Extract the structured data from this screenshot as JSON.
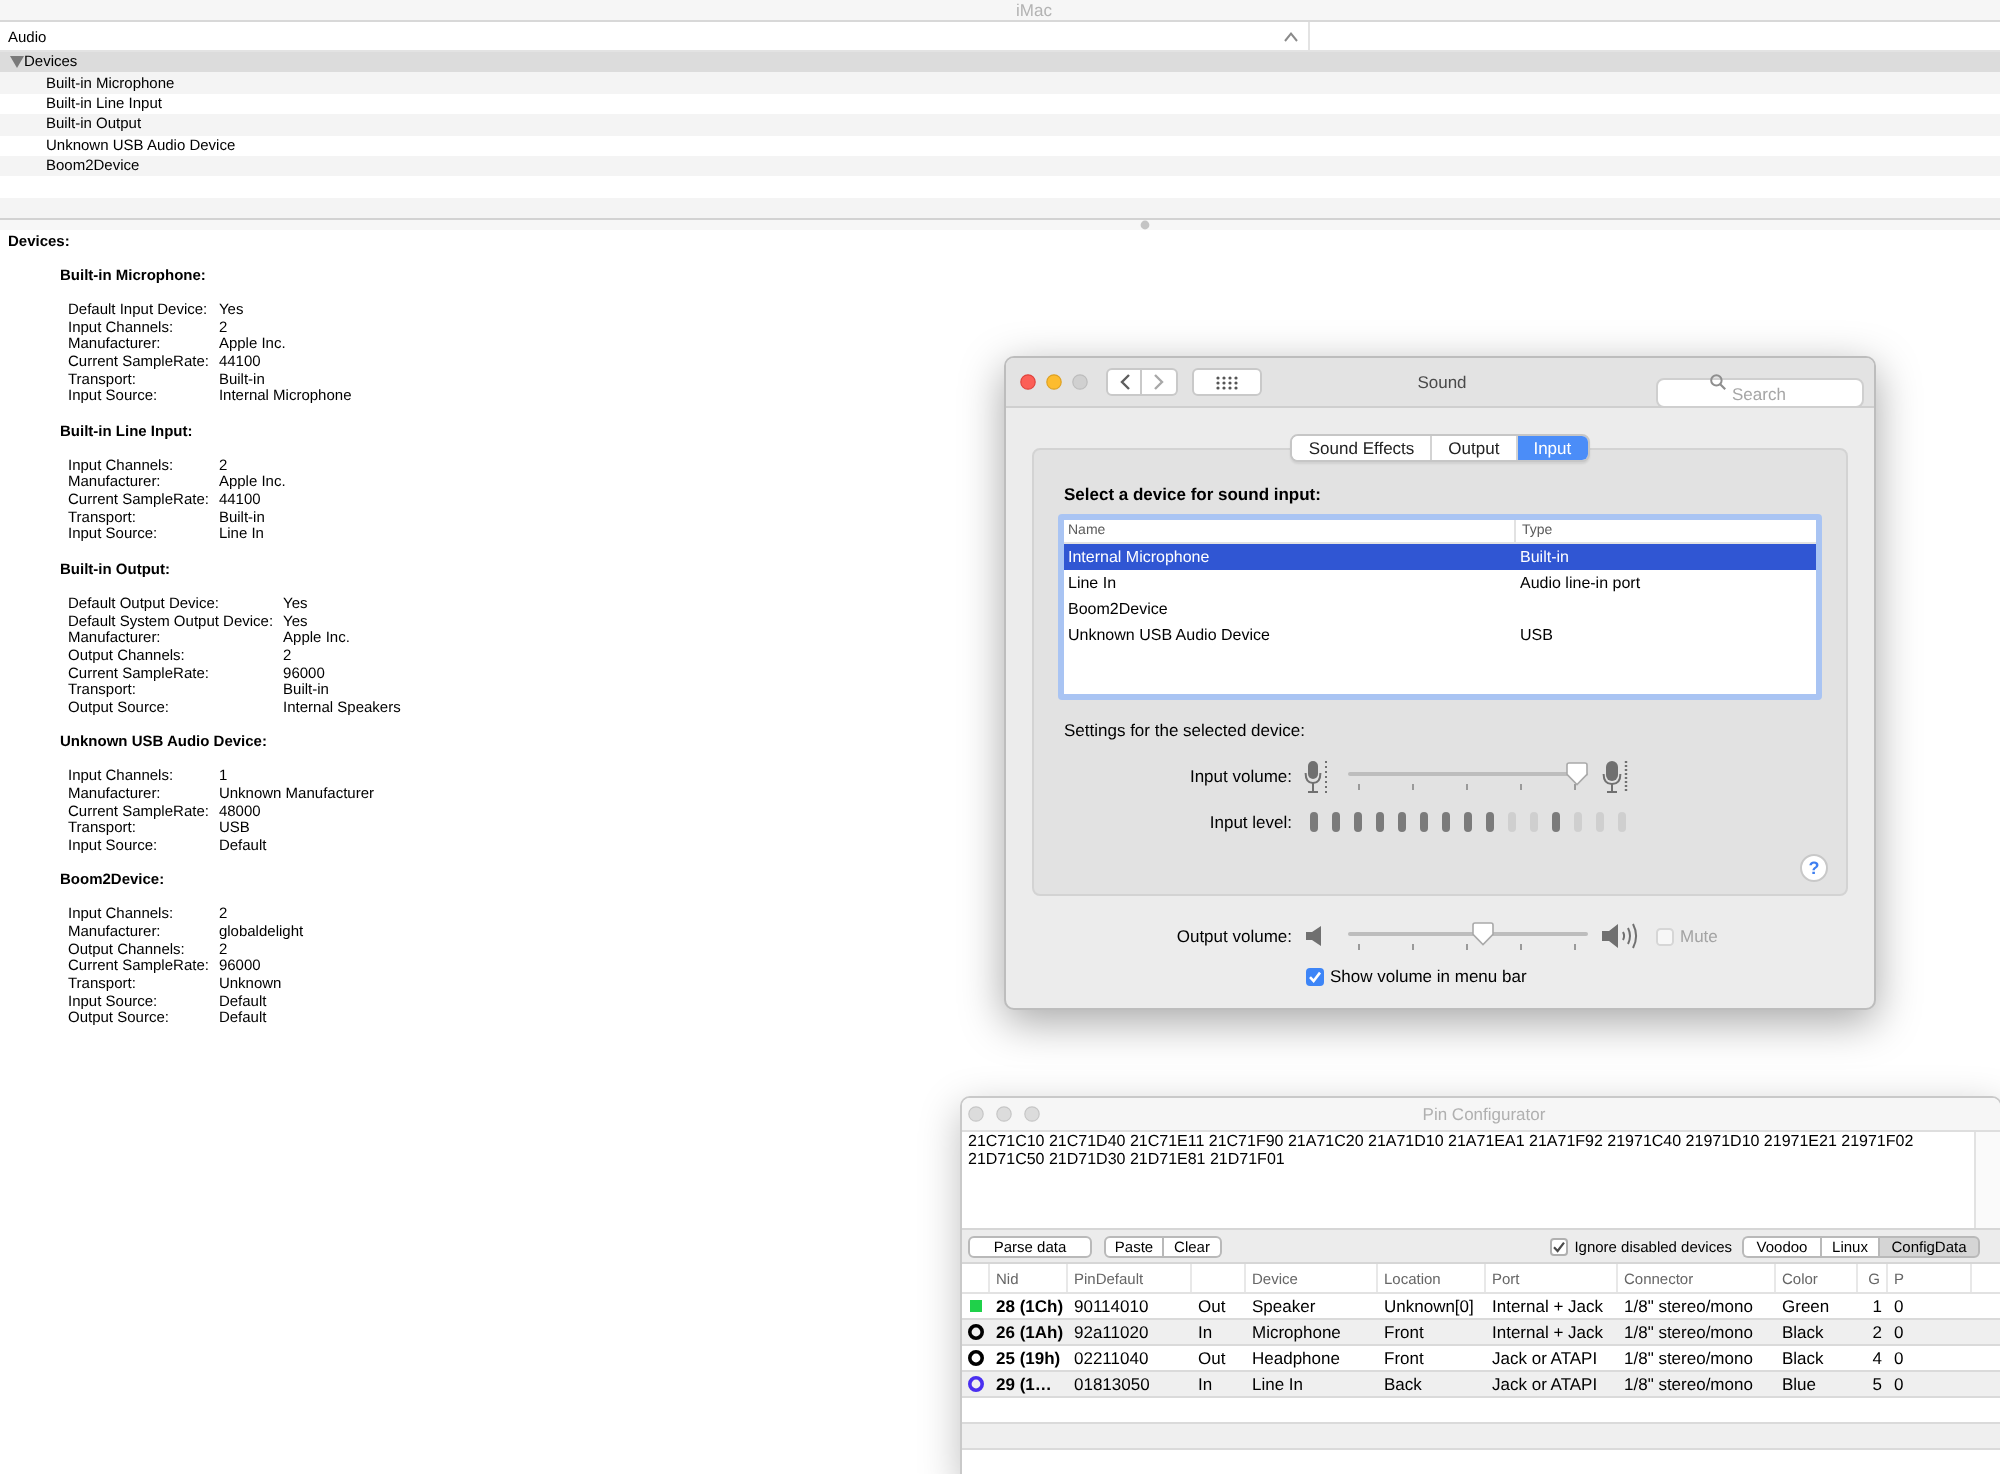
{
  "main_window": {
    "title": "iMac",
    "outline": {
      "column": "Audio",
      "items": [
        {
          "label": "Devices",
          "expanded": true,
          "selected": true,
          "children": [
            {
              "label": "Built-in Microphone",
              "selected": false
            },
            {
              "label": "Built-in Line Input",
              "selected": false
            },
            {
              "label": "Built-in Output",
              "selected": false
            },
            {
              "label": "Unknown USB Audio Device",
              "selected": false
            },
            {
              "label": "Boom2Device",
              "selected": false
            }
          ]
        }
      ]
    },
    "detail": {
      "heading": "Devices:",
      "sections": [
        {
          "title": "Built-in Microphone:",
          "fields": [
            {
              "key": "Default Input Device:",
              "value": "Yes"
            },
            {
              "key": "Input Channels:",
              "value": "2"
            },
            {
              "key": "Manufacturer:",
              "value": "Apple Inc."
            },
            {
              "key": "Current SampleRate:",
              "value": "44100"
            },
            {
              "key": "Transport:",
              "value": "Built-in"
            },
            {
              "key": "Input Source:",
              "value": "Internal Microphone"
            }
          ]
        },
        {
          "title": "Built-in Line Input:",
          "fields": [
            {
              "key": "Input Channels:",
              "value": "2"
            },
            {
              "key": "Manufacturer:",
              "value": "Apple Inc."
            },
            {
              "key": "Current SampleRate:",
              "value": "44100"
            },
            {
              "key": "Transport:",
              "value": "Built-in"
            },
            {
              "key": "Input Source:",
              "value": "Line In"
            }
          ]
        },
        {
          "title": "Built-in Output:",
          "fields": [
            {
              "key": "Default Output Device:",
              "value": "Yes"
            },
            {
              "key": "Default System Output Device:",
              "value": "Yes"
            },
            {
              "key": "Manufacturer:",
              "value": "Apple Inc."
            },
            {
              "key": "Output Channels:",
              "value": "2"
            },
            {
              "key": "Current SampleRate:",
              "value": "96000"
            },
            {
              "key": "Transport:",
              "value": "Built-in"
            },
            {
              "key": "Output Source:",
              "value": "Internal Speakers"
            }
          ]
        },
        {
          "title": "Unknown USB Audio Device:",
          "fields": [
            {
              "key": "Input Channels:",
              "value": "1"
            },
            {
              "key": "Manufacturer:",
              "value": "Unknown Manufacturer"
            },
            {
              "key": "Current SampleRate:",
              "value": "48000"
            },
            {
              "key": "Transport:",
              "value": "USB"
            },
            {
              "key": "Input Source:",
              "value": "Default"
            }
          ]
        },
        {
          "title": "Boom2Device:",
          "fields": [
            {
              "key": "Input Channels:",
              "value": "2"
            },
            {
              "key": "Manufacturer:",
              "value": "globaldelight"
            },
            {
              "key": "Output Channels:",
              "value": "2"
            },
            {
              "key": "Current SampleRate:",
              "value": "96000"
            },
            {
              "key": "Transport:",
              "value": "Unknown"
            },
            {
              "key": "Input Source:",
              "value": "Default"
            },
            {
              "key": "Output Source:",
              "value": "Default"
            }
          ]
        }
      ]
    }
  },
  "sound_window": {
    "title": "Sound",
    "search": {
      "placeholder": "Search"
    },
    "tabs": [
      {
        "label": "Sound Effects",
        "selected": false
      },
      {
        "label": "Output",
        "selected": false
      },
      {
        "label": "Input",
        "selected": true
      }
    ],
    "prompt": "Select a device for sound input:",
    "device_table": {
      "columns": [
        "Name",
        "Type"
      ],
      "rows": [
        {
          "name": "Internal Microphone",
          "type": "Built-in",
          "selected": true
        },
        {
          "name": "Line In",
          "type": "Audio line-in port",
          "selected": false
        },
        {
          "name": "Boom2Device",
          "selected": false
        },
        {
          "name": "Unknown USB Audio Device",
          "type": "USB",
          "selected": false
        }
      ]
    },
    "settings_label": "Settings for the selected device:",
    "input_volume": {
      "label": "Input volume:",
      "level": 1
    },
    "input_level": {
      "label": "Input level:",
      "segments": [
        {
          "lit": true
        },
        {
          "lit": true
        },
        {
          "lit": true
        },
        {
          "lit": true
        },
        {
          "lit": true
        },
        {
          "lit": true
        },
        {
          "lit": true
        },
        {
          "lit": true
        },
        {
          "lit": true
        },
        {
          "lit": false
        },
        {
          "lit": false
        },
        {
          "lit": true
        },
        {
          "lit": false
        },
        {
          "lit": false
        },
        {
          "lit": false
        }
      ]
    },
    "help": "?",
    "output_volume": {
      "label": "Output volume:",
      "level": 0.57
    },
    "mute": {
      "label": "Mute",
      "checked": false,
      "disabled": true
    },
    "show_volume": {
      "label": "Show volume in menu bar",
      "checked": true
    }
  },
  "pin_window": {
    "title": "Pin Configurator",
    "config_text": "21C71C10 21C71D40 21C71E11 21C71F90 21A71C20 21A71D10 21A71EA1 21A71F92 21971C40 21971D10 21971E21 21971F02 21D71C50 21D71D30 21D71E81 21D71F01",
    "parse_button": "Parse data",
    "edit_buttons": [
      "Paste",
      "Clear"
    ],
    "ignore_disabled": {
      "label": "Ignore disabled devices",
      "checked": true
    },
    "modes": [
      {
        "label": "Voodoo",
        "selected": false
      },
      {
        "label": "Linux",
        "selected": false
      },
      {
        "label": "ConfigData",
        "selected": true
      }
    ],
    "table": {
      "columns": {
        "nid": "Nid",
        "pin_default": "PinDefault",
        "device": "Device",
        "location": "Location",
        "port": "Port",
        "connector": "Connector",
        "color_text": "Color",
        "g": "G",
        "p": "P"
      },
      "rows": [
        {
          "kind": "square",
          "color": "#1fd14a",
          "nid": "28 (1Ch)",
          "pin_default": "90114010",
          "column_4": "Out",
          "device": "Speaker",
          "location": "Unknown[0]",
          "port": "Internal + Jack",
          "connector": "1/8\" stereo/mono",
          "color_text": "Green",
          "g": "1",
          "p": "0"
        },
        {
          "kind": "ring",
          "color": "#000000",
          "nid": "26 (1Ah)",
          "pin_default": "92a11020",
          "column_4": "In",
          "device": "Microphone",
          "location": "Front",
          "port": "Internal + Jack",
          "connector": "1/8\" stereo/mono",
          "color_text": "Black",
          "g": "2",
          "p": "0"
        },
        {
          "kind": "ring",
          "color": "#000000",
          "nid": "25 (19h)",
          "pin_default": "02211040",
          "column_4": "Out",
          "device": "Headphone",
          "location": "Front",
          "port": "Jack or ATAPI",
          "connector": "1/8\" stereo/mono",
          "color_text": "Black",
          "g": "4",
          "p": "0"
        },
        {
          "kind": "ring",
          "color": "#4a2ff0",
          "nid": "29 (1…",
          "pin_default": "01813050",
          "column_4": "In",
          "device": "Line In",
          "location": "Back",
          "port": "Jack or ATAPI",
          "connector": "1/8\" stereo/mono",
          "color_text": "Blue",
          "g": "5",
          "p": "0"
        }
      ]
    }
  }
}
